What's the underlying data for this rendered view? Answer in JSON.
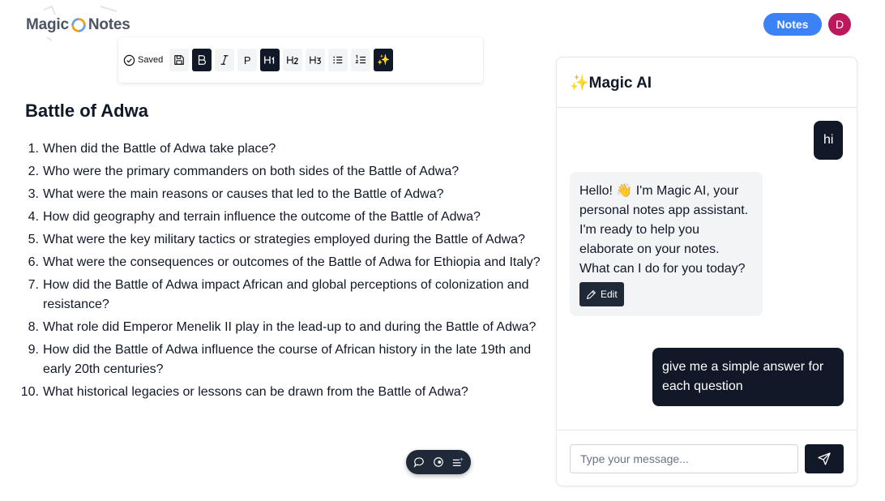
{
  "header": {
    "logo_left": "Magic",
    "logo_right": "Notes",
    "notes_button": "Notes",
    "avatar_initial": "D"
  },
  "toolbar": {
    "saved_label": "Saved",
    "buttons": [
      "save",
      "bold",
      "italic",
      "paragraph",
      "heading-1",
      "heading-2",
      "heading-3",
      "bullet-list",
      "numbered-list",
      "magic"
    ],
    "paragraph_label": "P",
    "magic_glyph": "✨"
  },
  "document": {
    "title": "Battle of Adwa",
    "questions": [
      {
        "num": "1.",
        "text": "When did the Battle of Adwa take place?"
      },
      {
        "num": "2.",
        "text": "Who were the primary commanders on both sides of the Battle of Adwa?"
      },
      {
        "num": "3.",
        "text": "What were the main reasons or causes that led to the Battle of Adwa?"
      },
      {
        "num": "4.",
        "text": "How did geography and terrain influence the outcome of the Battle of Adwa?"
      },
      {
        "num": "5.",
        "text": "What were the key military tactics or strategies employed during the Battle of Adwa?"
      },
      {
        "num": "6.",
        "text": "What were the consequences or outcomes of the Battle of Adwa for Ethiopia and Italy?"
      },
      {
        "num": "7.",
        "text": "How did the Battle of Adwa impact African and global perceptions of colonization and resistance?"
      },
      {
        "num": "8.",
        "text": "What role did Emperor Menelik II play in the lead-up to and during the Battle of Adwa?"
      },
      {
        "num": "9.",
        "text": "How did the Battle of Adwa influence the course of African history in the late 19th and early 20th centuries?"
      },
      {
        "num": "10.",
        "text": "What historical legacies or lessons can be drawn from the Battle of Adwa?"
      }
    ]
  },
  "chat": {
    "title": "✨Magic AI",
    "messages": {
      "user_1": "hi",
      "ai_1": "Hello! 👋 I'm Magic AI, your personal notes app assistant. I'm ready to help you elaborate on your notes. What can I do for you today?",
      "user_2": "give me a simple answer for each question"
    },
    "edit_label": "Edit",
    "input_placeholder": "Type your message...",
    "input_value": ""
  },
  "colors": {
    "accent": "#3b82f6",
    "avatar": "#be185d",
    "dark": "#111827"
  }
}
